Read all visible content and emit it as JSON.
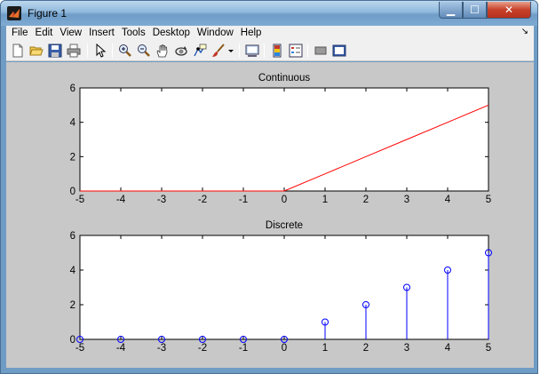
{
  "window": {
    "title": "Figure 1",
    "controls": {
      "minimize": "▁",
      "maximize": "☐",
      "close": "✕"
    }
  },
  "menubar": {
    "items": [
      "File",
      "Edit",
      "View",
      "Insert",
      "Tools",
      "Desktop",
      "Window",
      "Help"
    ],
    "overflow_arrow": "↘"
  },
  "toolbar": {
    "icons": [
      "new-figure-icon",
      "open-file-icon",
      "save-icon",
      "print-icon",
      "pointer-icon",
      "zoom-in-icon",
      "zoom-out-icon",
      "pan-hand-icon",
      "rotate-3d-icon",
      "data-cursor-icon",
      "brush-icon",
      "brush-dropdown-icon",
      "link-plot-icon",
      "insert-colorbar-icon",
      "insert-legend-icon",
      "hide-plot-tools-icon",
      "show-plot-tools-icon"
    ]
  },
  "chart_data": [
    {
      "type": "line",
      "title": "Continuous",
      "xlabel": "",
      "ylabel": "",
      "xlim": [
        -5,
        5
      ],
      "ylim": [
        0,
        6
      ],
      "xticks": [
        "-5",
        "-4",
        "-3",
        "-2",
        "-1",
        "0",
        "1",
        "2",
        "3",
        "4",
        "5"
      ],
      "yticks": [
        "0",
        "2",
        "4",
        "6"
      ],
      "x": [
        -5,
        -4,
        -3,
        -2,
        -1,
        0,
        1,
        2,
        3,
        4,
        5
      ],
      "y": [
        0,
        0,
        0,
        0,
        0,
        0,
        1,
        2,
        3,
        4,
        5
      ],
      "color": "#ff0000",
      "grid": false
    },
    {
      "type": "stem",
      "title": "Discrete",
      "xlabel": "",
      "ylabel": "",
      "xlim": [
        -5,
        5
      ],
      "ylim": [
        0,
        6
      ],
      "xticks": [
        "-5",
        "-4",
        "-3",
        "-2",
        "-1",
        "0",
        "1",
        "2",
        "3",
        "4",
        "5"
      ],
      "yticks": [
        "0",
        "2",
        "4",
        "6"
      ],
      "x": [
        -5,
        -4,
        -3,
        -2,
        -1,
        0,
        1,
        2,
        3,
        4,
        5
      ],
      "y": [
        0,
        0,
        0,
        0,
        0,
        0,
        1,
        2,
        3,
        4,
        5
      ],
      "color": "#0000ff",
      "marker": "circle",
      "grid": false
    }
  ]
}
